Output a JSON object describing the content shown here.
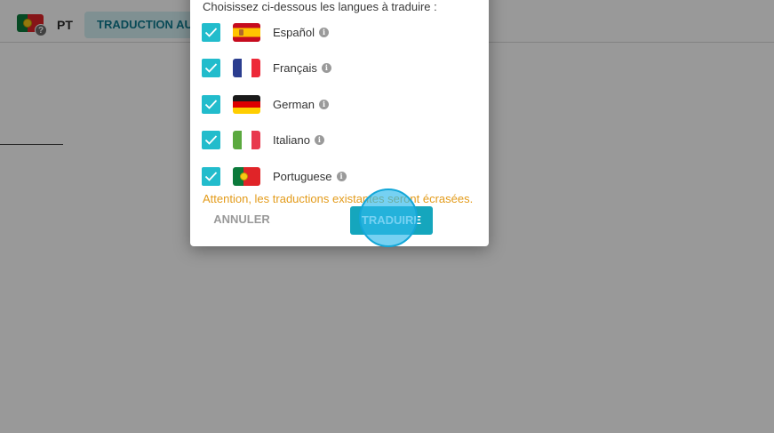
{
  "background": {
    "language_code": "PT",
    "auto_translate_label": "TRADUCTION AUTOMATIQUE",
    "help_badge": "?"
  },
  "dialog": {
    "heading": "Choisissez ci-dessous les langues à traduire :",
    "languages": [
      {
        "label": "Español",
        "checked": true,
        "flag": "es"
      },
      {
        "label": "Français",
        "checked": true,
        "flag": "fr"
      },
      {
        "label": "German",
        "checked": true,
        "flag": "de"
      },
      {
        "label": "Italiano",
        "checked": true,
        "flag": "it"
      },
      {
        "label": "Portuguese",
        "checked": true,
        "flag": "pt"
      }
    ],
    "info_glyph": "i",
    "warning": "Attention, les traductions existantes seront écrasées.",
    "cancel_label": "ANNULER",
    "translate_label": "TRADUIRE"
  },
  "colors": {
    "accent": "#22bccc",
    "primary_button": "#15a6bd",
    "warning": "#e39b1a"
  },
  "icons": [
    "portugal-flag-icon",
    "help-icon",
    "checkbox-checked-icon",
    "info-icon",
    "spain-flag-icon",
    "france-flag-icon",
    "germany-flag-icon",
    "italy-flag-icon"
  ]
}
